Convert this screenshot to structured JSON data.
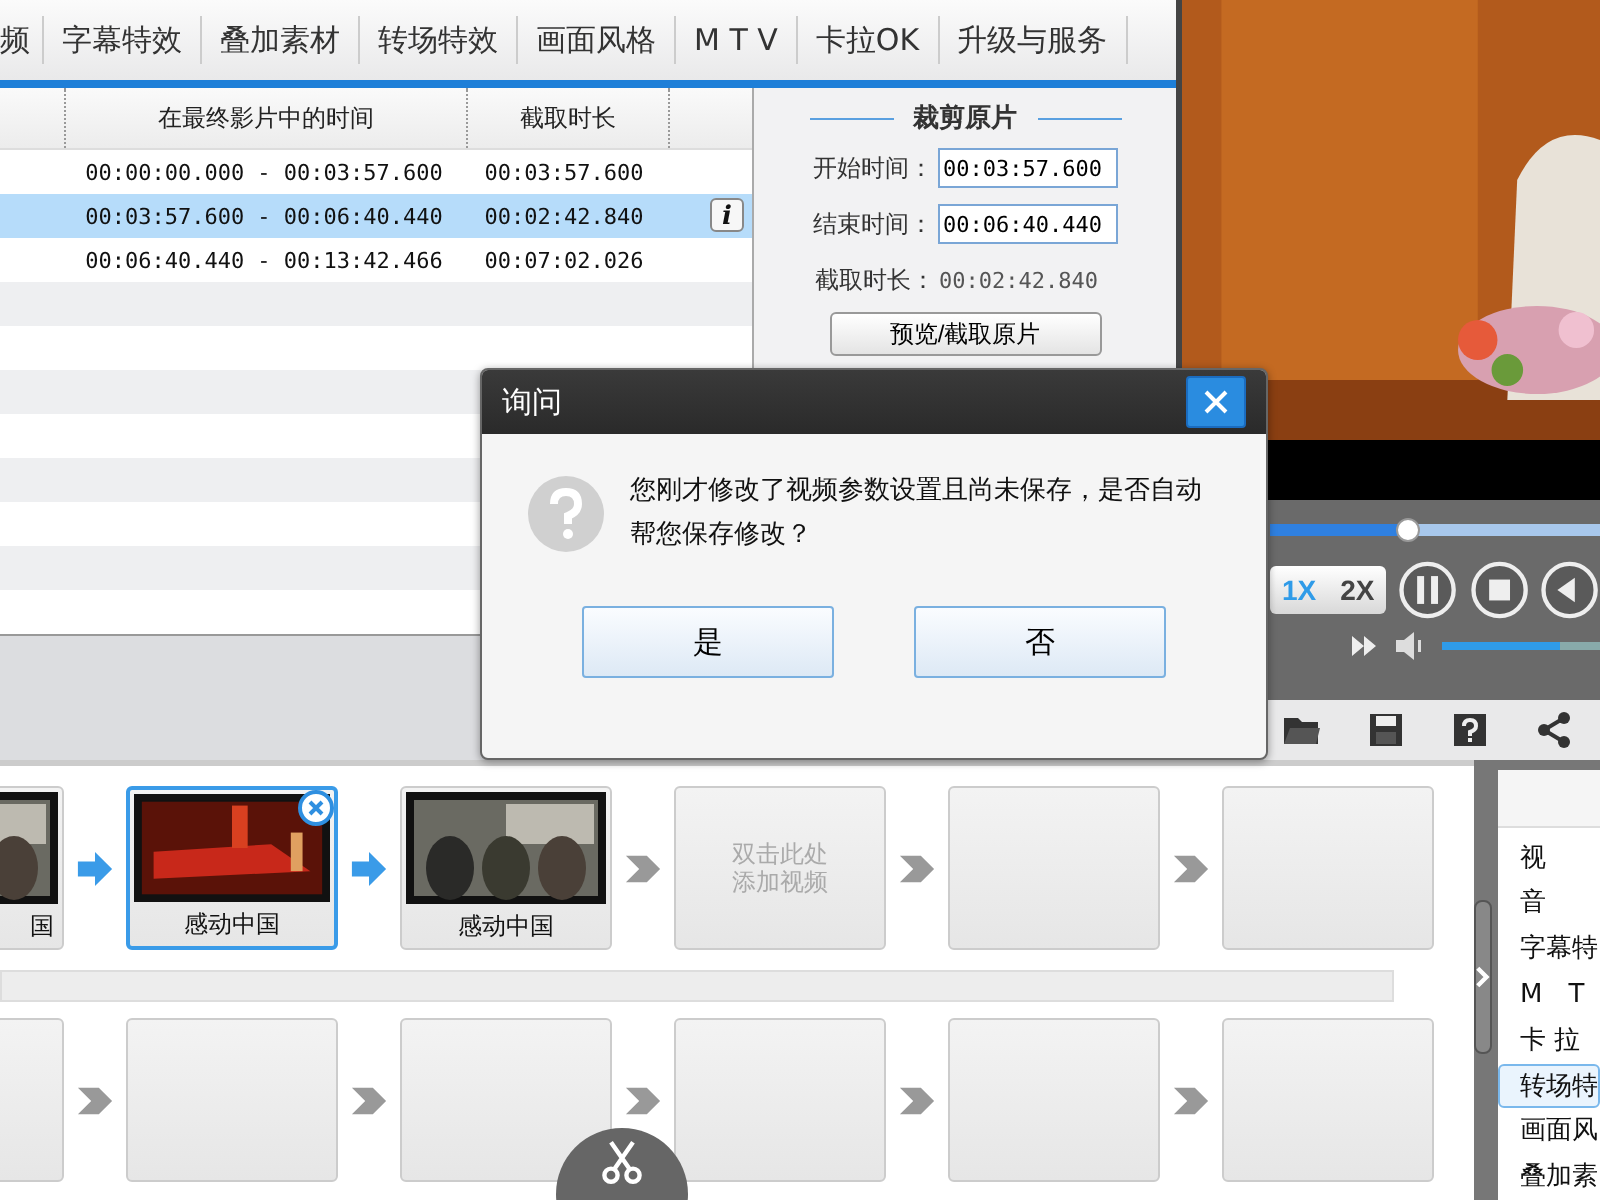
{
  "tabs": [
    {
      "label": "频",
      "selected": false
    },
    {
      "label": "字幕特效",
      "selected": false
    },
    {
      "label": "叠加素材",
      "selected": false
    },
    {
      "label": "转场特效",
      "selected": false
    },
    {
      "label": "画面风格",
      "selected": false
    },
    {
      "label": "M T V",
      "selected": false
    },
    {
      "label": "卡拉OK",
      "selected": false
    },
    {
      "label": "升级与服务",
      "selected": false
    }
  ],
  "table": {
    "columns": [
      "在最终影片中的时间",
      "截取时长"
    ],
    "rows": [
      {
        "range": "00:00:00.000 - 00:03:57.600",
        "duration": "00:03:57.600",
        "selected": false
      },
      {
        "range": "00:03:57.600 - 00:06:40.440",
        "duration": "00:02:42.840",
        "selected": true,
        "info": "i"
      },
      {
        "range": "00:06:40.440 - 00:13:42.466",
        "duration": "00:07:02.026",
        "selected": false
      }
    ]
  },
  "crop_panel": {
    "title": "裁剪原片",
    "start_label": "开始时间：",
    "start_value": "00:03:57.600",
    "end_label": "结束时间：",
    "end_value": "00:06:40.440",
    "duration_label": "截取时长：",
    "duration_value": "00:02:42.840",
    "button": "预览/截取原片"
  },
  "player": {
    "progress": {
      "level": 0.42
    },
    "speeds": [
      {
        "label": "1X",
        "selected": true
      },
      {
        "label": "2X",
        "selected": false
      }
    ],
    "volume": {
      "level": 0.75
    }
  },
  "storyboard": {
    "video_track": [
      {
        "kind": "clip",
        "caption": "国",
        "selected": false
      },
      {
        "kind": "clip",
        "caption": "感动中国",
        "selected": true
      },
      {
        "kind": "clip",
        "caption": "感动中国",
        "selected": false
      },
      {
        "kind": "placeholder",
        "hint": "双击此处添加视频"
      },
      {
        "kind": "empty"
      },
      {
        "kind": "empty"
      }
    ],
    "second_track": [
      {
        "kind": "empty"
      },
      {
        "kind": "empty"
      },
      {
        "kind": "empty"
      },
      {
        "kind": "empty"
      },
      {
        "kind": "empty"
      },
      {
        "kind": "empty"
      }
    ]
  },
  "side_list": [
    {
      "label": "视",
      "selected": false
    },
    {
      "label": "音",
      "selected": false
    },
    {
      "label": "字幕特",
      "selected": false
    },
    {
      "label": "M　T",
      "selected": false
    },
    {
      "label": "卡 拉",
      "selected": false
    },
    {
      "label": "转场特",
      "selected": true
    },
    {
      "label": "画面风",
      "selected": false
    },
    {
      "label": "叠加素",
      "selected": false
    }
  ],
  "dialog": {
    "title": "询问",
    "message": "您刚才修改了视频参数设置且尚未保存，是否自动帮您保存修改？",
    "buttons": [
      "是",
      "否"
    ]
  }
}
